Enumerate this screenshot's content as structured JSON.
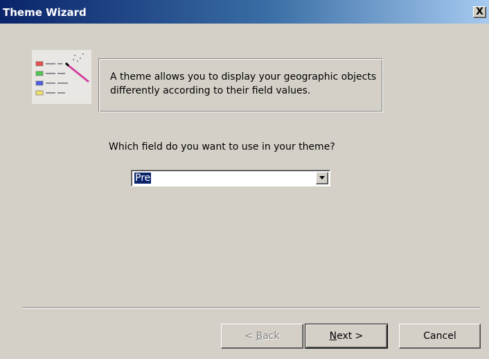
{
  "window": {
    "title": "Theme Wizard",
    "close_glyph": "X"
  },
  "intro": {
    "description": "A theme allows you to display your geographic objects differently according to their field values."
  },
  "field_selection": {
    "question": "Which field do you want to use in your theme?",
    "selected_value": "Pre"
  },
  "buttons": {
    "back": {
      "prefix": "< ",
      "accel": "B",
      "rest": "ack",
      "enabled": false
    },
    "next": {
      "accel": "N",
      "rest": "ext >",
      "enabled": true
    },
    "cancel": {
      "label": "Cancel",
      "enabled": true
    }
  },
  "icons": {
    "wizard": "theme-wizard-icon",
    "combo_arrow": "chevron-down-icon"
  },
  "colors": {
    "title_start": "#0a246a",
    "title_end": "#a6caf0",
    "selection": "#0a246a",
    "face": "#d4d0c8"
  }
}
